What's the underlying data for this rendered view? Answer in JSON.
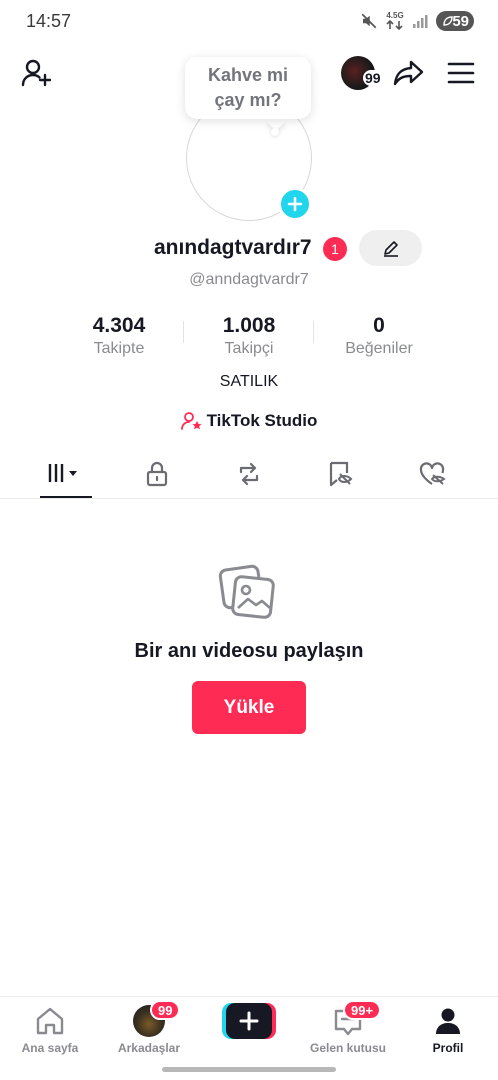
{
  "status_bar": {
    "time": "14:57",
    "network": "4.5G",
    "battery": "59",
    "icons": [
      "mute-icon",
      "network-4g-icon",
      "signal-icon",
      "battery-icon"
    ]
  },
  "top_bar": {
    "avatar_count": "99",
    "icons": [
      "add-friend-icon",
      "share-icon",
      "menu-icon"
    ]
  },
  "profile": {
    "bubble_text": "Kahve mi çay mı?",
    "username": "anındagtvardır7",
    "notification_count": "1",
    "handle": "@anndagtvardr7",
    "bio": "SATILIK",
    "studio_label": "TikTok Studio"
  },
  "stats": [
    {
      "value": "4.304",
      "label": "Takipte"
    },
    {
      "value": "1.008",
      "label": "Takipçi"
    },
    {
      "value": "0",
      "label": "Beğeniler"
    }
  ],
  "tabs": [
    "videos-grid-icon",
    "lock-icon",
    "repost-icon",
    "tagged-icon",
    "liked-icon"
  ],
  "empty_state": {
    "title": "Bir anı videosu paylaşın",
    "button": "Yükle"
  },
  "bottom_nav": {
    "home": "Ana sayfa",
    "friends": "Arkadaşlar",
    "friends_badge": "99",
    "inbox": "Gelen kutusu",
    "inbox_badge": "99+",
    "profile": "Profil"
  },
  "colors": {
    "accent": "#fe2c55",
    "cyan": "#20d5ec",
    "text": "#161823",
    "muted": "#8a8b91"
  }
}
